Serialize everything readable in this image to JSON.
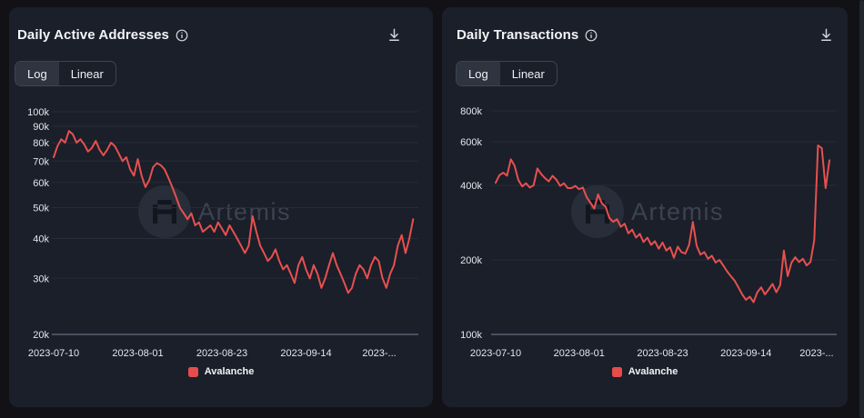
{
  "watermark": {
    "text": "Artemis"
  },
  "colors": {
    "accent_red": "#e7504e",
    "legend_red": "#e74c4c",
    "panel_bg": "#1a1f2a",
    "outer_bg": "#121216",
    "gridline": "#272c37",
    "axis_line": "#5a6170",
    "tick_text": "#e4e7ec"
  },
  "panels": [
    {
      "title": "Daily Active Addresses",
      "scale_toggle": {
        "options": [
          "Log",
          "Linear"
        ],
        "selected": "Log"
      },
      "legend": [
        {
          "label": "Avalanche",
          "color": "#e74c4c"
        }
      ],
      "chart_data": {
        "type": "line",
        "scale": "log",
        "title": "Daily Active Addresses",
        "x_start": "2023-07-10",
        "x_interval_days": 1,
        "x_tick_labels": [
          "2023-07-10",
          "2023-08-01",
          "2023-08-23",
          "2023-09-14",
          "2023-..."
        ],
        "x_tick_days": [
          0,
          22,
          44,
          66,
          88
        ],
        "ylim": [
          20000,
          100000
        ],
        "y_ticks": [
          {
            "label": "100k",
            "value": 100000
          },
          {
            "label": "90k",
            "value": 90000
          },
          {
            "label": "80k",
            "value": 80000
          },
          {
            "label": "70k",
            "value": 70000
          },
          {
            "label": "60k",
            "value": 60000
          },
          {
            "label": "50k",
            "value": 50000
          },
          {
            "label": "40k",
            "value": 40000
          },
          {
            "label": "30k",
            "value": 30000
          },
          {
            "label": "20k",
            "value": 20000
          }
        ],
        "series": [
          {
            "name": "Avalanche",
            "color": "#e7504e",
            "values": [
              72000,
              78000,
              82000,
              80000,
              87000,
              85000,
              80000,
              82000,
              79000,
              75000,
              77000,
              81000,
              76000,
              73000,
              76000,
              80000,
              78000,
              74000,
              70000,
              72000,
              66000,
              63000,
              71000,
              63000,
              58000,
              61000,
              67000,
              69000,
              68000,
              66000,
              62000,
              58000,
              54000,
              50000,
              48000,
              46000,
              48000,
              44000,
              45000,
              42000,
              43000,
              44000,
              42000,
              45000,
              43000,
              41000,
              44000,
              42000,
              40000,
              38000,
              36000,
              38000,
              47000,
              42000,
              38000,
              36000,
              34000,
              35000,
              37000,
              34000,
              32000,
              33000,
              31000,
              29000,
              33000,
              35000,
              32000,
              30000,
              33000,
              31000,
              28000,
              30000,
              33000,
              36000,
              33000,
              31000,
              29000,
              27000,
              28000,
              31000,
              33000,
              32000,
              30000,
              33000,
              35000,
              34000,
              30000,
              28000,
              31000,
              33000,
              38000,
              41000,
              36000,
              40000,
              46000
            ]
          }
        ]
      }
    },
    {
      "title": "Daily Transactions",
      "scale_toggle": {
        "options": [
          "Log",
          "Linear"
        ],
        "selected": "Log"
      },
      "legend": [
        {
          "label": "Avalanche",
          "color": "#e74c4c"
        }
      ],
      "chart_data": {
        "type": "line",
        "scale": "log",
        "title": "Daily Transactions",
        "x_start": "2023-07-10",
        "x_interval_days": 1,
        "x_tick_labels": [
          "2023-07-10",
          "2023-08-01",
          "2023-08-23",
          "2023-09-14",
          "2023-..."
        ],
        "x_tick_days": [
          0,
          22,
          44,
          66,
          88
        ],
        "ylim": [
          100000,
          800000
        ],
        "y_ticks": [
          {
            "label": "800k",
            "value": 800000
          },
          {
            "label": "600k",
            "value": 600000
          },
          {
            "label": "400k",
            "value": 400000
          },
          {
            "label": "200k",
            "value": 200000
          },
          {
            "label": "100k",
            "value": 100000
          }
        ],
        "series": [
          {
            "name": "Avalanche",
            "color": "#e7504e",
            "values": [
              410000,
              440000,
              450000,
              438000,
              510000,
              480000,
              420000,
              396000,
              408000,
              392000,
              400000,
              468000,
              445000,
              428000,
              415000,
              437000,
              422000,
              398000,
              408000,
              390000,
              390000,
              398000,
              386000,
              392000,
              358000,
              340000,
              322000,
              368000,
              338000,
              328000,
              295000,
              285000,
              292000,
              272000,
              280000,
              256000,
              265000,
              246000,
              255000,
              236000,
              246000,
              230000,
              238000,
              222000,
              235000,
              218000,
              225000,
              204000,
              226000,
              215000,
              212000,
              230000,
              285000,
              228000,
              210000,
              215000,
              202000,
              208000,
              195000,
              200000,
              190000,
              180000,
              172000,
              165000,
              155000,
              145000,
              138000,
              142000,
              135000,
              148000,
              155000,
              145000,
              152000,
              160000,
              148000,
              158000,
              218000,
              172000,
              195000,
              205000,
              196000,
              202000,
              190000,
              196000,
              240000,
              580000,
              565000,
              390000,
              505000
            ]
          }
        ]
      }
    }
  ]
}
